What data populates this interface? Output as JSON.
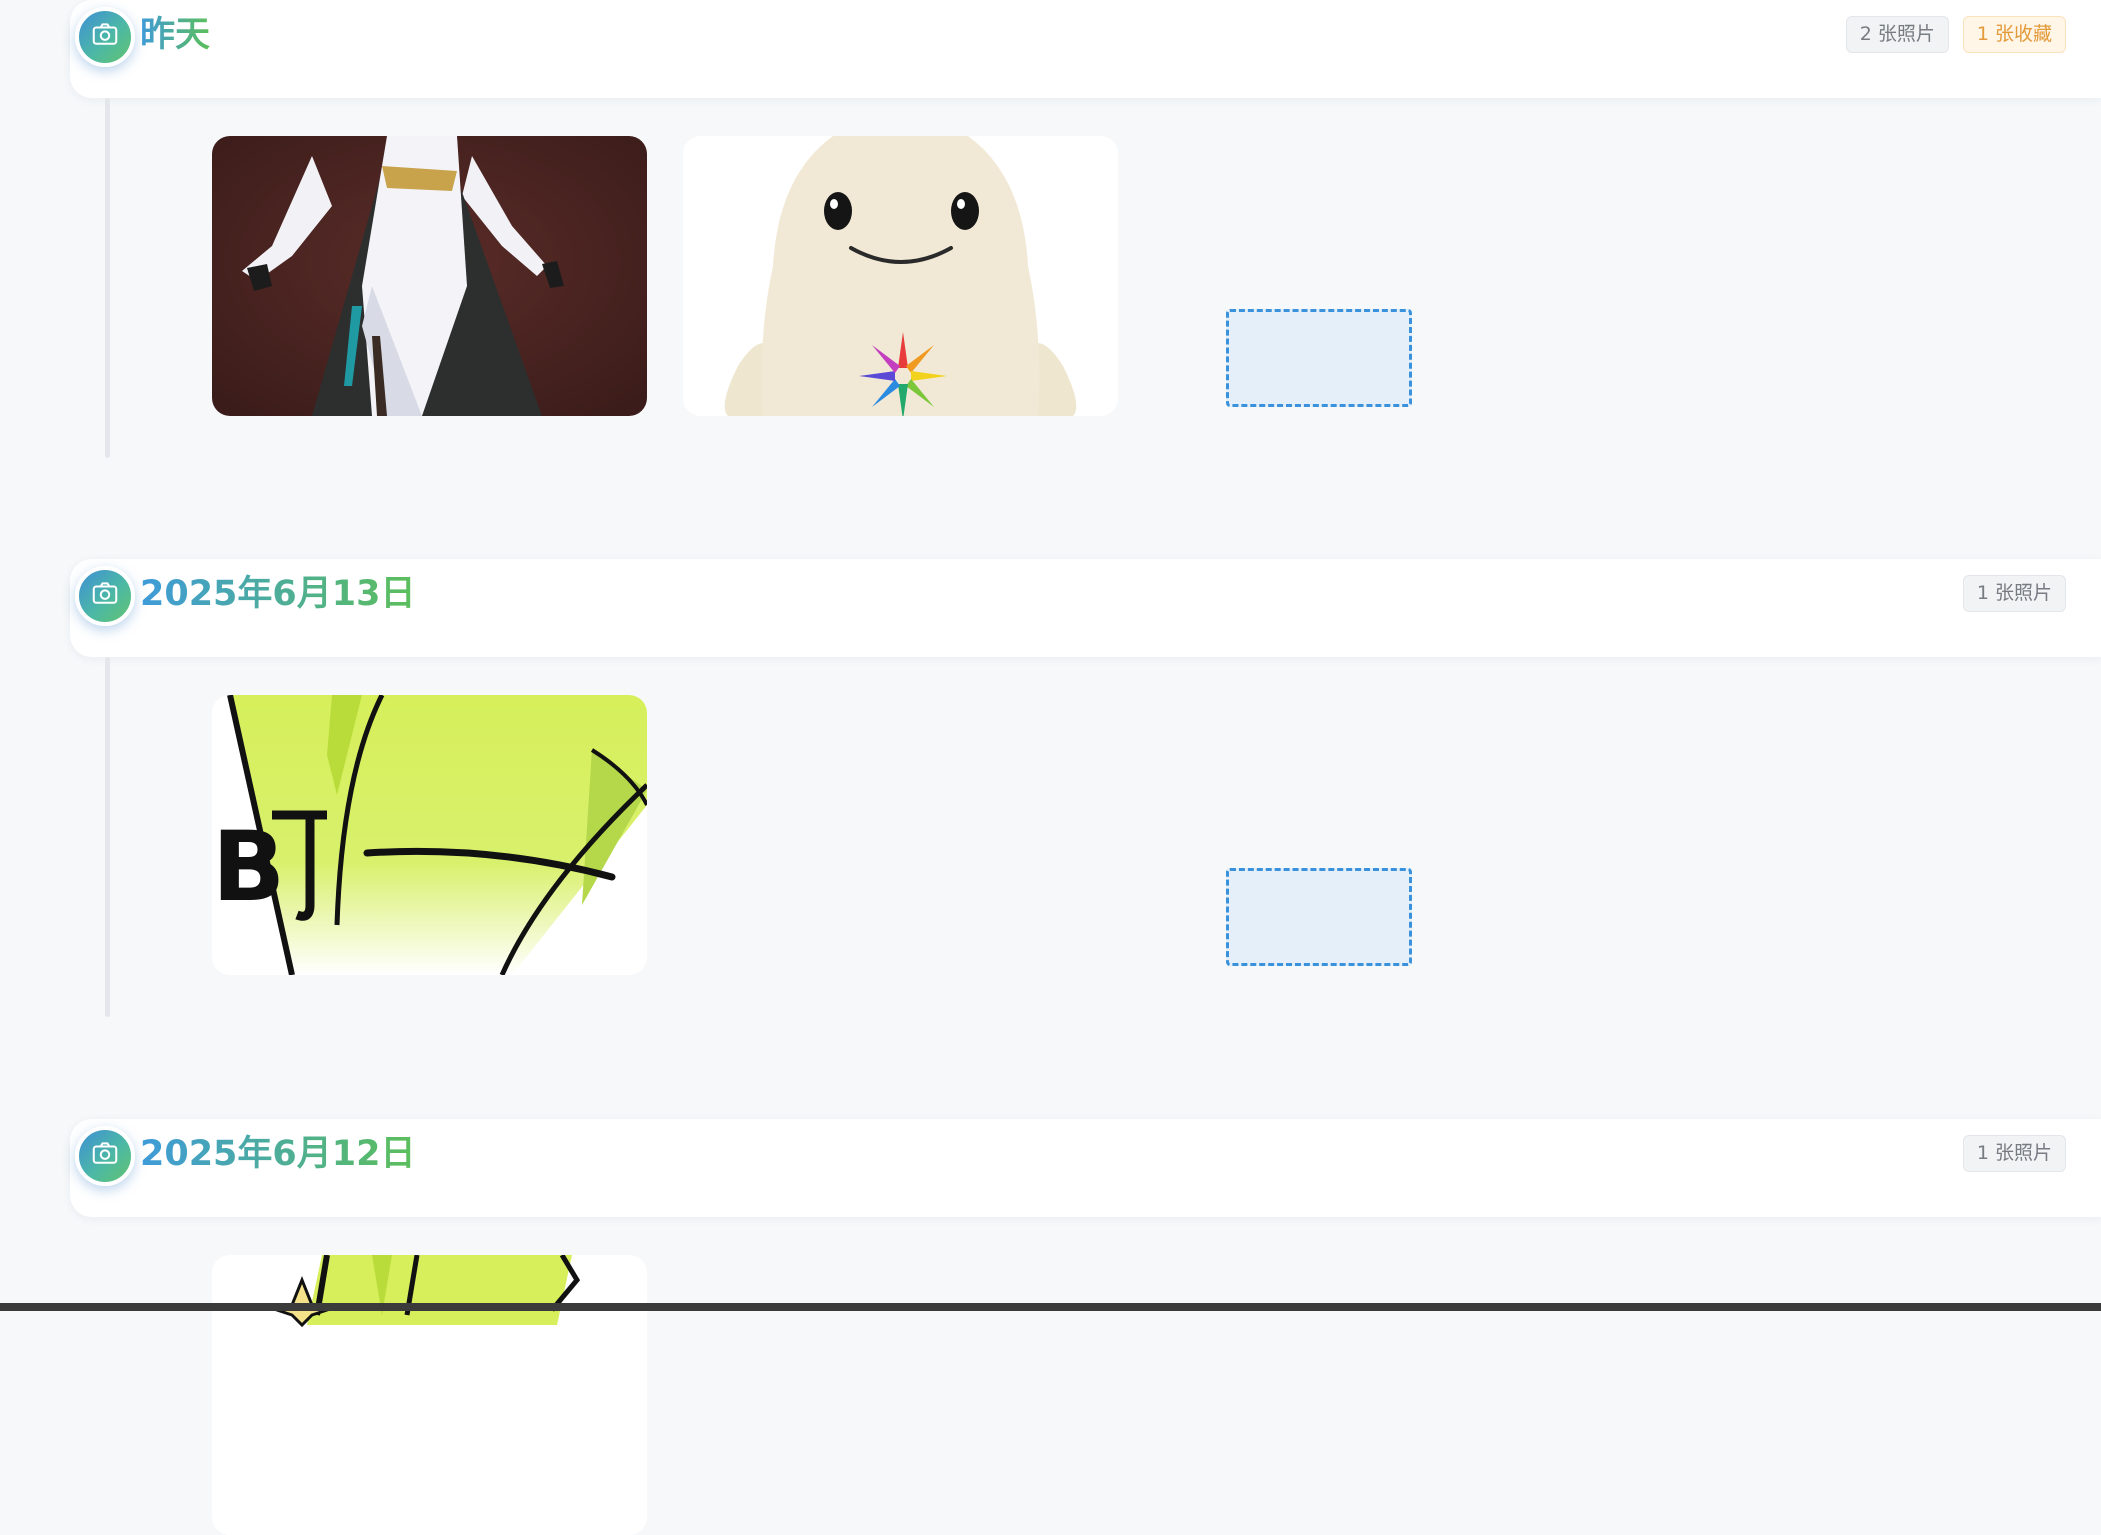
{
  "groups": [
    {
      "date": "昨天",
      "photo_count": "2 张照片",
      "favorite_count": "1 张收藏",
      "photos": [
        {
          "subject": "anime character in white dress"
        },
        {
          "subject": "cream plush toy with rainbow flower"
        }
      ]
    },
    {
      "date": "2025年6月13日",
      "photo_count": "1 张照片",
      "photos": [
        {
          "subject": "lime green cartoon sticker"
        }
      ]
    },
    {
      "date": "2025年6月12日",
      "photo_count": "1 张照片",
      "photos": [
        {
          "subject": "lime green cartoon sticker with sparkle"
        }
      ]
    }
  ],
  "colors": {
    "title_gradient_start": "#3f9bd9",
    "title_gradient_end": "#5cbf5a",
    "drop_zone_border": "#3a92dc",
    "favorite_badge_text": "#e39a3a"
  }
}
